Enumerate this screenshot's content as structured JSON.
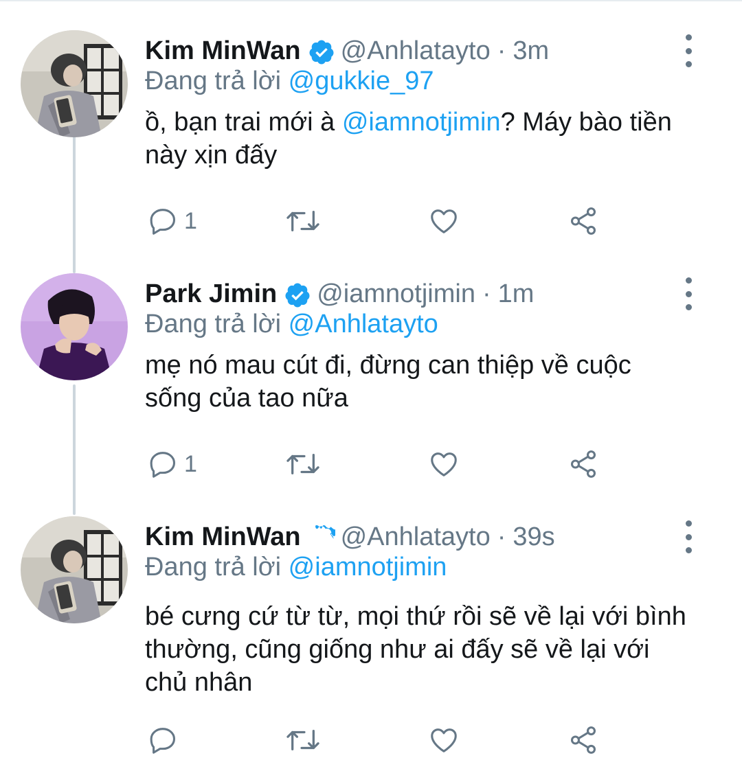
{
  "tweets": [
    {
      "author_name": "Kim MinWan",
      "verified": true,
      "handle": "@Anhlatayto",
      "separator": "·",
      "time": "3m",
      "replying_prefix": "Đang trả lời",
      "replying_to": "@gukkie_97",
      "text_before": "ồ, bạn trai mới à ",
      "text_mention": "@iamnotjimin",
      "text_after": "?  Máy bào tiền này xịn đấy",
      "reply_count": "1",
      "avatar": "avatar-kim-minwan"
    },
    {
      "author_name": "Park Jimin",
      "verified": true,
      "handle": "@iamnotjimin",
      "separator": "·",
      "time": "1m",
      "replying_prefix": "Đang trả lời",
      "replying_to": "@Anhlatayto",
      "text": "mẹ nó mau cút đi, đừng can thiệp về cuộc sống của tao nữa",
      "reply_count": "1",
      "avatar": "avatar-park-jimin"
    },
    {
      "author_name": "Kim MinWan",
      "verified": true,
      "handle": "@Anhlatayto",
      "separator": "·",
      "time": "39s",
      "replying_prefix": "Đang trả lời",
      "replying_to": "@iamnotjimin",
      "text": "bé cưng cứ từ từ, mọi thứ rồi sẽ về lại với bình thường, cũng giống như ai đấy sẽ về lại với chủ nhân",
      "reply_count": "",
      "avatar": "avatar-kim-minwan"
    }
  ],
  "icons": {
    "reply": "reply-bubble-icon",
    "retweet": "retweet-icon",
    "like": "heart-icon",
    "share": "share-icon",
    "more": "more-vertical-icon",
    "verified": "verified-badge-icon"
  },
  "colors": {
    "text": "#14171a",
    "secondary": "#657786",
    "link": "#1da1f2",
    "thread_line": "#ccd6dd"
  }
}
